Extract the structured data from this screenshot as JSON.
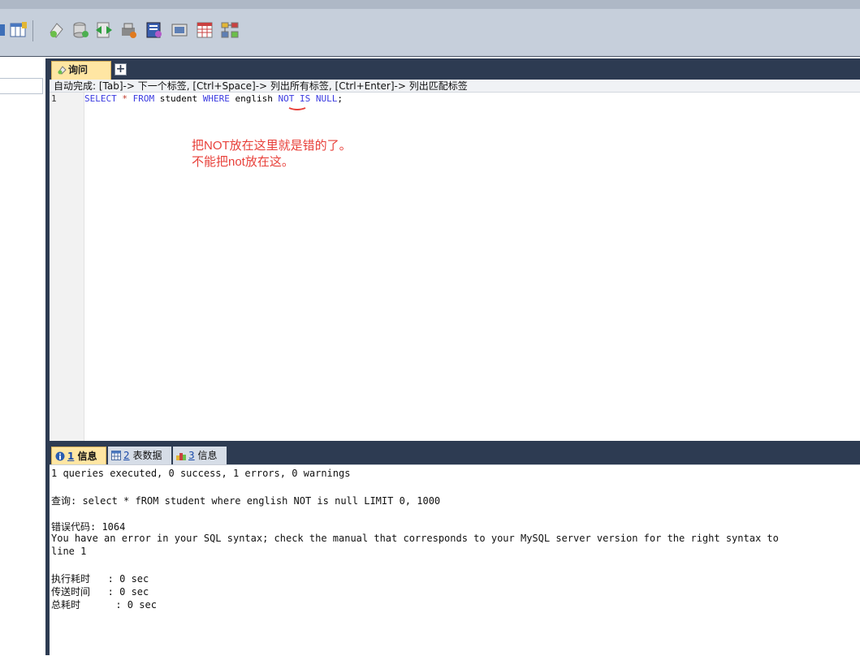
{
  "toolbar": {
    "icons": [
      "table-icon",
      "new-query-icon",
      "database-icon",
      "schema-sync-icon",
      "data-transfer-icon",
      "import-icon",
      "backup-icon",
      "schedule-icon",
      "schema-designer-icon"
    ]
  },
  "editor": {
    "tab_label": "询问",
    "add_tab_label": "+",
    "autocomplete_hint": "自动完成: [Tab]-> 下一个标签, [Ctrl+Space]-> 列出所有标签, [Ctrl+Enter]-> 列出匹配标签",
    "line_number": "1",
    "code": {
      "select": "SELECT",
      "star": "*",
      "from": "FROM",
      "table": "student",
      "where": "WHERE",
      "column": "english",
      "not": "NOT",
      "is": "IS",
      "null": "NULL",
      "semicolon": ";"
    },
    "annotation_line1": "把NOT放在这里就是错的了。",
    "annotation_line2": "不能把not放在这。"
  },
  "results": {
    "tabs": [
      {
        "num": "1",
        "label": "信息"
      },
      {
        "num": "2",
        "label": "表数据"
      },
      {
        "num": "3",
        "label": "信息"
      }
    ],
    "summary": "1 queries executed, 0 success, 1 errors, 0 warnings",
    "query_line": "查询: select * fROM student where english NOT is null LIMIT 0, 1000",
    "error_code_line": "错误代码: 1064",
    "error_message": "You have an error in your SQL syntax; check the manual that corresponds to your MySQL server version for the right syntax to",
    "error_message_cont": "line 1",
    "exec_time": "执行耗时   : 0 sec",
    "transfer_time": "传送时间   : 0 sec",
    "total_time": "总耗时      : 0 sec"
  }
}
